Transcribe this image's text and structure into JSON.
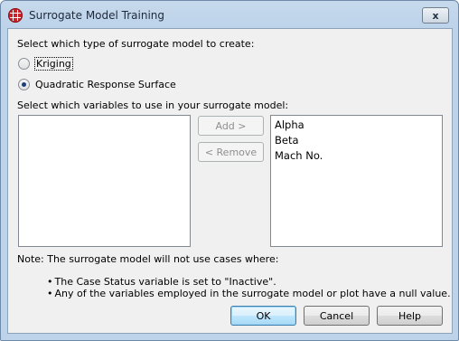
{
  "window": {
    "title": "Surrogate Model Training",
    "close_glyph": "x"
  },
  "model_type": {
    "prompt": "Select which type of surrogate model to create:",
    "options": [
      {
        "label": "Kriging",
        "selected": false
      },
      {
        "label": "Quadratic Response Surface",
        "selected": true
      }
    ]
  },
  "variables": {
    "prompt": "Select which variables to use in your surrogate model:",
    "available": [],
    "selected": [
      "Alpha",
      "Beta",
      "Mach No."
    ],
    "add_label": "Add >",
    "remove_label": "< Remove"
  },
  "note": {
    "text": "Note: The surrogate model will not use cases where:",
    "bullets": [
      "The Case Status variable is set to \"Inactive\".",
      "Any of the variables employed in the surrogate model or plot have a null value."
    ],
    "bullet_glyph": "•"
  },
  "buttons": {
    "ok": "OK",
    "cancel": "Cancel",
    "help": "Help"
  }
}
